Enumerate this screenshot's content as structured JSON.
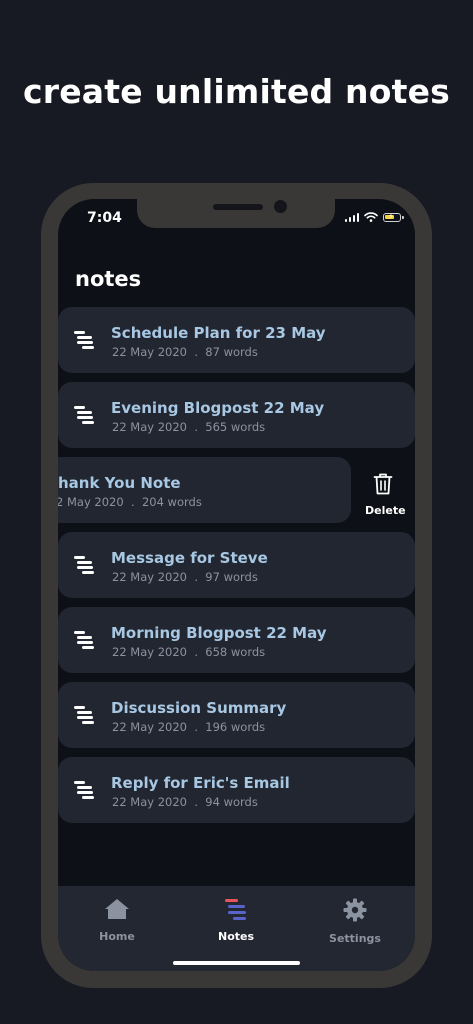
{
  "headline": "create unlimited notes",
  "status_bar": {
    "time": "7:04",
    "battery_color": "#f4d23b"
  },
  "page_title": "notes",
  "notes": [
    {
      "title": "Schedule Plan for 23 May",
      "date": "22 May 2020",
      "words": "87 words"
    },
    {
      "title": "Evening Blogpost 22 May",
      "date": "22 May 2020",
      "words": "565 words"
    },
    {
      "title": "hank You Note",
      "date": "2 May 2020",
      "words": "204 words"
    },
    {
      "title": "Message for Steve",
      "date": "22 May 2020",
      "words": "97 words"
    },
    {
      "title": "Morning Blogpost 22 May",
      "date": "22 May 2020",
      "words": "658 words"
    },
    {
      "title": "Discussion Summary",
      "date": "22 May 2020",
      "words": "196 words"
    },
    {
      "title": "Reply for Eric's Email",
      "date": "22 May 2020",
      "words": "94 words"
    }
  ],
  "meta_separator": ".",
  "delete_label": "Delete",
  "tabs": [
    {
      "label": "Home",
      "icon": "home-icon"
    },
    {
      "label": "Notes",
      "icon": "notes-icon"
    },
    {
      "label": "Settings",
      "icon": "gear-icon"
    }
  ],
  "colors": {
    "background": "#171a22",
    "card": "#222630",
    "title_accent": "#a7c7e3",
    "notes_tab_blue": "#5a63c8",
    "notes_tab_red": "#e8535d"
  }
}
